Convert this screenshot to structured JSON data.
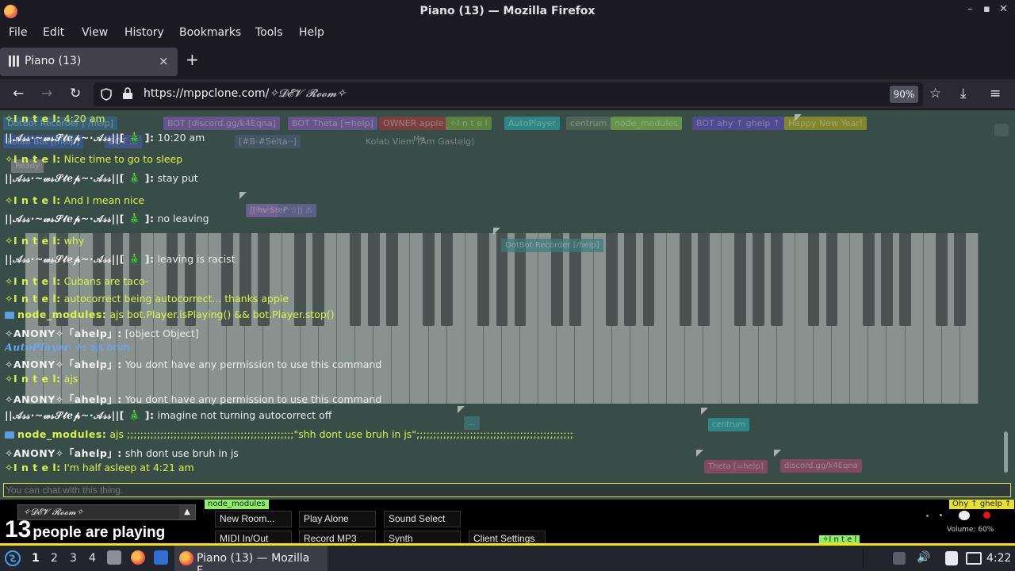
{
  "window": {
    "title": "Piano (13) — Mozilla Firefox",
    "controls": [
      "–",
      "▪",
      "✕"
    ]
  },
  "menu": [
    "File",
    "Edit",
    "View",
    "History",
    "Bookmarks",
    "Tools",
    "Help"
  ],
  "tab": {
    "label": "Piano (13)",
    "close": "×",
    "new_tab": "+"
  },
  "nav": {
    "back": "←",
    "forward": "→",
    "reload": "↻",
    "url_main": "https://mppclone.com/",
    "url_room": "✧𝓓𝓔𝓥 𝓡𝓸𝓸𝓶✧",
    "zoom": "90%",
    "star": "☆",
    "download": "⤓",
    "menu": "≡"
  },
  "room_tags": [
    {
      "text": "DotBot Recorder [ /help]",
      "color": "#3a6a8a"
    },
    {
      "text": "BOT  [discord.gg/k4Eqna]",
      "color": "#7a5aa8"
    },
    {
      "text": "BOT  Theta [=help]",
      "color": "#7a5aa8"
    },
    {
      "text": "OWNER  apple",
      "color": "#9a3a3a"
    },
    {
      "text": "✧I n t e l",
      "color": "#6a9a3a"
    },
    {
      "text": "AutoPlayer",
      "color": "#2aa0a0"
    },
    {
      "text": "centrum",
      "color": "#5a7060"
    },
    {
      "text": "node_modules",
      "color": "#7ab04a"
    },
    {
      "text": "BOT  ahy ↑ ghelp ↑",
      "color": "#5a4ab0"
    },
    {
      "text": "Happy New Year!",
      "color": "#a0a020"
    },
    {
      "text": "kolab Bot [/help]",
      "color": "#3a5aa0"
    },
    {
      "text": "BOT  ...",
      "color": "#4a5aa0"
    },
    {
      "text": "[#B·#Selta··]",
      "color": "#4a5a70"
    },
    {
      "text": "Kolab Viem (Am Gasteig)",
      "color": "transparent"
    }
  ],
  "cursor_labels": [
    {
      "text": "Me",
      "color": "transparent"
    },
    {
      "text": "Theta",
      "color": "#a05070"
    },
    {
      "text": "||·hv·SteP·☆|| ⚠",
      "color": "#6a6aa0"
    },
    {
      "text": "DotBot Recorder [/help]",
      "color": "#3a7a7a"
    },
    {
      "text": "...",
      "color": "#3a7a7a"
    },
    {
      "text": "centrum",
      "color": "#2aa0a0"
    },
    {
      "text": "Theta [=help]",
      "color": "#a04a6a"
    },
    {
      "text": "discord.gg/k4Eqna",
      "color": "#a04a6a"
    },
    {
      "text": "Ready",
      "color": "#8a8a8a"
    }
  ],
  "chat": [
    {
      "name": "✧I n t e l:",
      "text": "4:20 am",
      "name_style": "lime",
      "text_style": "lime"
    },
    {
      "name": "||𝒜𝓈𝓈·~𝓌𝓈𝒮𝓉ℯ𝓅~·𝒜𝓈𝓈||[ 🎄 ]:",
      "text": "10:20 am",
      "name_style": "",
      "text_style": "dim"
    },
    {
      "name": "✧I n t e l:",
      "text": "Nice time to go to sleep",
      "name_style": "lime",
      "text_style": "lime"
    },
    {
      "name": "||𝒜𝓈𝓈·~𝓌𝓈𝒮𝓉ℯ𝓅~·𝒜𝓈𝓈||[ 🎄 ]:",
      "text": "stay put",
      "name_style": "",
      "text_style": "dim"
    },
    {
      "name": "✧I n t e l:",
      "text": "And I mean nice",
      "name_style": "lime",
      "text_style": "lime"
    },
    {
      "name": "||𝒜𝓈𝓈·~𝓌𝓈𝒮𝓉ℯ𝓅~·𝒜𝓈𝓈||[ 🎄 ]:",
      "text": "no leaving",
      "name_style": "",
      "text_style": "dim"
    },
    {
      "name": "✧I n t e l:",
      "text": "why",
      "name_style": "lime",
      "text_style": "lime"
    },
    {
      "name": "||𝒜𝓈𝓈·~𝓌𝓈𝒮𝓉ℯ𝓅~·𝒜𝓈𝓈||[ 🎄 ]:",
      "text": "leaving is racist",
      "name_style": "",
      "text_style": "dim"
    },
    {
      "name": "✧I n t e l:",
      "text": "Cubans are taco-",
      "name_style": "lime",
      "text_style": "lime"
    },
    {
      "name": "✧I n t e l:",
      "text": "autocorrect being autocorrect... thanks apple",
      "name_style": "lime",
      "text_style": "lime"
    },
    {
      "name": "node_modules:",
      "text": "ajs bot.Player.isPlaying() && bot.Player.stop()",
      "name_style": "lime",
      "text_style": "lime",
      "folder": true
    },
    {
      "name": "✧ANONY✧「ahelp」:",
      "text": "[object Object]",
      "name_style": "",
      "text_style": "dim"
    },
    {
      "name": "AutoPlayer ✧:",
      "text": "ajs bruh",
      "name_style": "blue",
      "text_style": "blue"
    },
    {
      "name": "✧ANONY✧「ahelp」:",
      "text": "You dont have any permission to use this command",
      "name_style": "",
      "text_style": "dim"
    },
    {
      "name": "✧I n t e l:",
      "text": "ajs",
      "name_style": "lime",
      "text_style": "lime"
    },
    {
      "name": "✧ANONY✧「ahelp」:",
      "text": "You dont have any permission to use this command",
      "name_style": "",
      "text_style": "dim"
    },
    {
      "name": "||𝒜𝓈𝓈·~𝓌𝓈𝒮𝓉ℯ𝓅~·𝒜𝓈𝓈||[ 🎄 ]:",
      "text": "imagine not turning autocorrect off",
      "name_style": "",
      "text_style": "dim"
    },
    {
      "name": "node_modules:",
      "text": "ajs ;;;;;;;;;;;;;;;;;;;;;;;;;;;;;;;;;;;;;;;;;;;;;;;;;;\"shh dont use bruh in js\";;;;;;;;;;;;;;;;;;;;;;;;;;;;;;;;;;;;;;;;;;;;;;;",
      "name_style": "lime",
      "text_style": "lime",
      "folder": true
    },
    {
      "name": "✧ANONY✧「ahelp」:",
      "text": "shh dont use bruh in js",
      "name_style": "",
      "text_style": "dim"
    },
    {
      "name": "✧I n t e l:",
      "text": "I'm half asleep at 4:21 am",
      "name_style": "lime",
      "text_style": "lime"
    }
  ],
  "chat_input": {
    "placeholder": "You can chat with this thing."
  },
  "panel": {
    "room": "✧𝓓𝓔𝓥 𝓡𝓸𝓸𝓶✧",
    "room_arrow": "▲",
    "count": "13",
    "count_text": "people are playing",
    "buttons": [
      "New Room...",
      "Play Alone",
      "Sound Select",
      "MIDI In/Out",
      "Record MP3",
      "Synth",
      "Client Settings"
    ],
    "green_tag": "node_modules",
    "green_tag_bottom": "✧I n t e l",
    "yellow_tag": "Ohy ↑ ghelp ↑",
    "volume": "Volume: 60%"
  },
  "taskbar": {
    "workspaces": [
      "1",
      "2",
      "3",
      "4"
    ],
    "task_label": "Piano (13) — Mozilla F...",
    "clock": "4:22"
  },
  "colors": {
    "accent": "#ffe000",
    "lime": "#d9f548",
    "background": "#384c48"
  }
}
